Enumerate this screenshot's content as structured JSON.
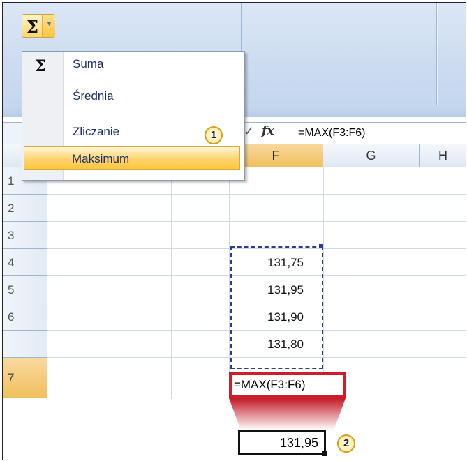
{
  "ribbon": {
    "autosum_icon": "sigma-icon",
    "autosum_dropdown_icon": "chevron-down-icon"
  },
  "autosum_menu": {
    "items": [
      {
        "label": "Suma",
        "icon": "sigma-icon"
      },
      {
        "label": "Średnia"
      },
      {
        "label": "Zliczanie"
      },
      {
        "label": "Maksimum",
        "highlighted": true
      }
    ]
  },
  "formula_bar": {
    "fx_label": "fx",
    "formula": "=MAX(F3:F6)"
  },
  "columns": [
    "F",
    "G",
    "H"
  ],
  "rows": [
    "1",
    "2",
    "3",
    "4",
    "5",
    "6",
    "7"
  ],
  "cells": {
    "F3": "131,75",
    "F4": "131,95",
    "F5": "131,90",
    "F6": "131,80",
    "F7": "=MAX(F3:F6)"
  },
  "result": {
    "value": "131,95"
  },
  "callouts": {
    "step1": "1",
    "step2": "2"
  },
  "colors": {
    "highlight_red": "#cc1f2b",
    "marquee_blue": "#2b3c8f",
    "marquee_yellow": "#f3d23a"
  }
}
